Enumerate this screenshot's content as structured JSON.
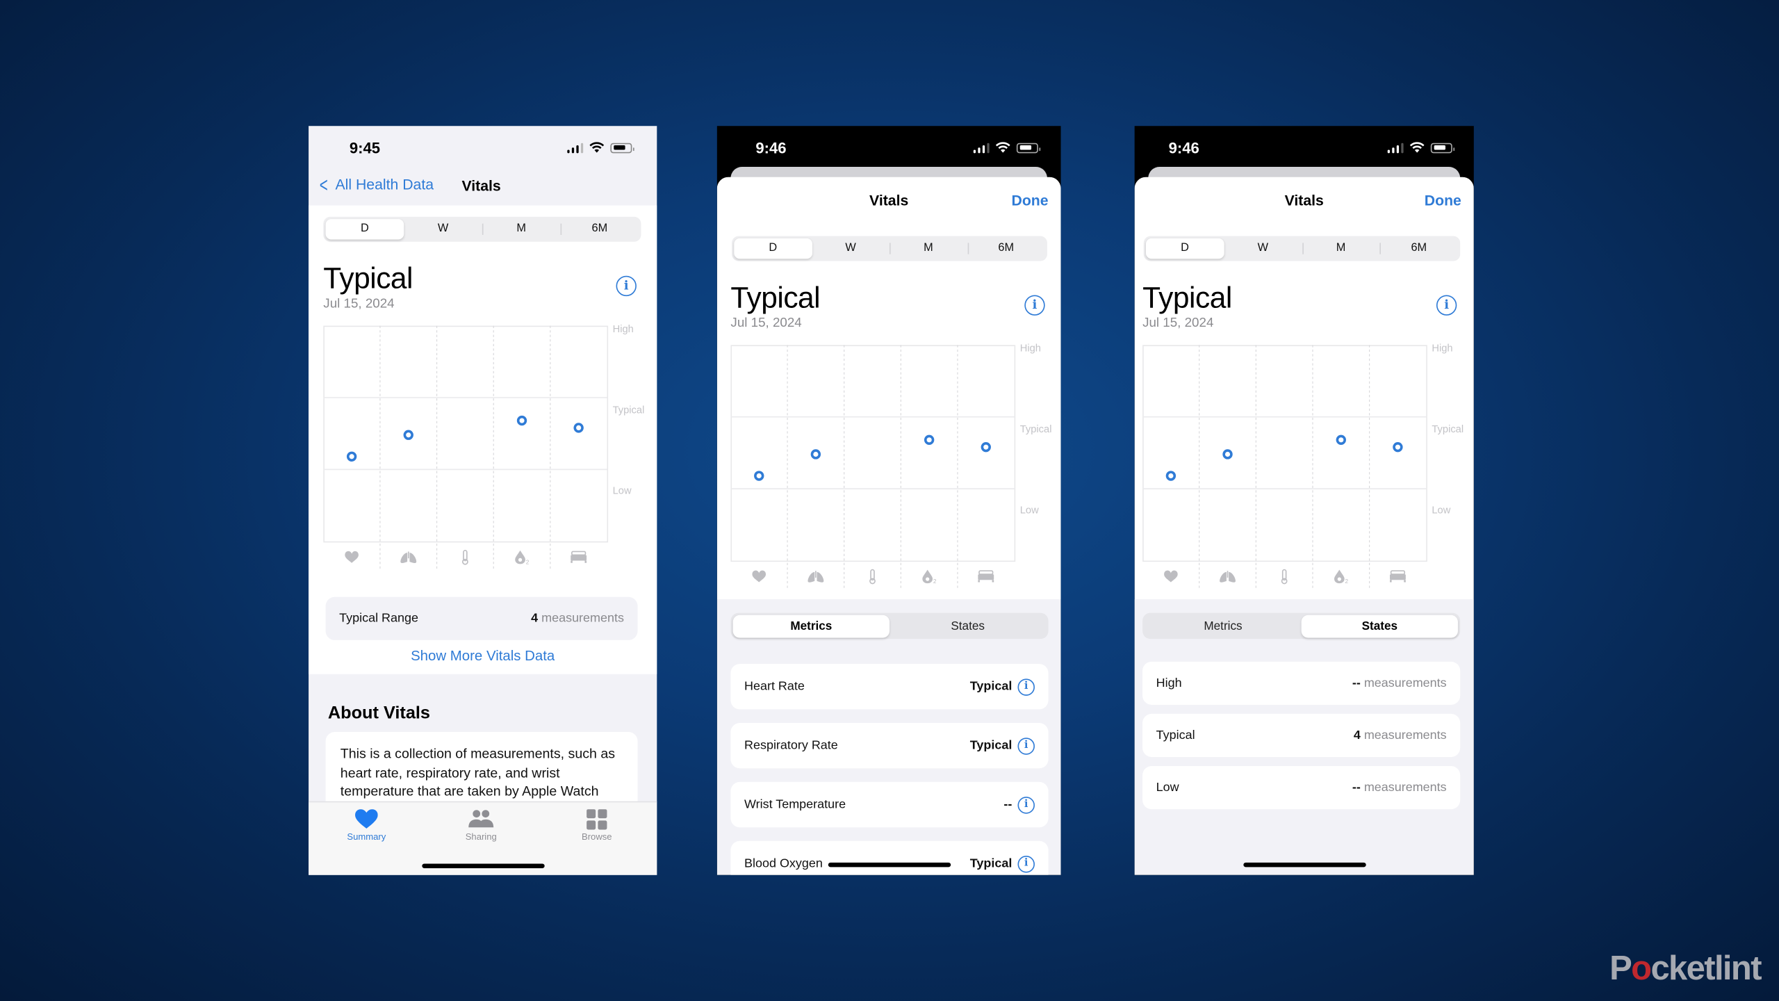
{
  "watermark": {
    "before": "P",
    "power_o": "o",
    "after": "cketlint"
  },
  "chart_data": {
    "type": "scatter",
    "title": "Vitals",
    "categories": [
      "Heart Rate",
      "Respiratory Rate",
      "Wrist Temperature",
      "Blood Oxygen",
      "Sleeping Breathing"
    ],
    "category_icons": [
      "heart-icon",
      "lungs-icon",
      "thermometer-icon",
      "blood-oxygen-icon",
      "bed-icon"
    ],
    "bands": [
      "High",
      "Typical",
      "Low"
    ],
    "ylim": [
      0,
      3
    ],
    "band_edges": [
      1,
      2
    ],
    "values": [
      1.18,
      1.48,
      null,
      1.68,
      1.58
    ],
    "point_color": "#2f7bd6",
    "xlabel": "",
    "ylabel": ""
  },
  "screens": [
    {
      "status_time": "9:45",
      "nav": {
        "back_label": "All Health Data",
        "title": "Vitals"
      },
      "ranges": [
        "D",
        "W",
        "M",
        "6M"
      ],
      "selected_range": "D",
      "headline": "Typical",
      "date": "Jul 15, 2024",
      "y_labels": [
        "High",
        "Typical",
        "Low"
      ],
      "summary": {
        "label": "Typical Range",
        "count": "4",
        "unit": "measurements"
      },
      "show_more": "Show More Vitals Data",
      "about": {
        "heading": "About Vitals",
        "text": "This is a collection of measurements, such as heart rate, respiratory rate, and wrist temperature that are taken by Apple Watch"
      },
      "tabs": [
        {
          "label": "Summary",
          "icon": "heart-fill-icon",
          "active": true
        },
        {
          "label": "Sharing",
          "icon": "people-icon",
          "active": false
        },
        {
          "label": "Browse",
          "icon": "grid-icon",
          "active": false
        }
      ]
    },
    {
      "status_time": "9:46",
      "sheet": {
        "title": "Vitals",
        "done_label": "Done"
      },
      "ranges": [
        "D",
        "W",
        "M",
        "6M"
      ],
      "selected_range": "D",
      "headline": "Typical",
      "date": "Jul 15, 2024",
      "y_labels": [
        "High",
        "Typical",
        "Low"
      ],
      "segments": [
        "Metrics",
        "States"
      ],
      "selected_segment": "Metrics",
      "metrics": [
        {
          "label": "Heart Rate",
          "status": "Typical"
        },
        {
          "label": "Respiratory Rate",
          "status": "Typical"
        },
        {
          "label": "Wrist Temperature",
          "status": "--"
        },
        {
          "label": "Blood Oxygen",
          "status": "Typical"
        }
      ]
    },
    {
      "status_time": "9:46",
      "sheet": {
        "title": "Vitals",
        "done_label": "Done"
      },
      "ranges": [
        "D",
        "W",
        "M",
        "6M"
      ],
      "selected_range": "D",
      "headline": "Typical",
      "date": "Jul 15, 2024",
      "y_labels": [
        "High",
        "Typical",
        "Low"
      ],
      "segments": [
        "Metrics",
        "States"
      ],
      "selected_segment": "States",
      "states": [
        {
          "label": "High",
          "count": "--",
          "unit": "measurements"
        },
        {
          "label": "Typical",
          "count": "4",
          "unit": "measurements"
        },
        {
          "label": "Low",
          "count": "--",
          "unit": "measurements"
        }
      ]
    }
  ]
}
